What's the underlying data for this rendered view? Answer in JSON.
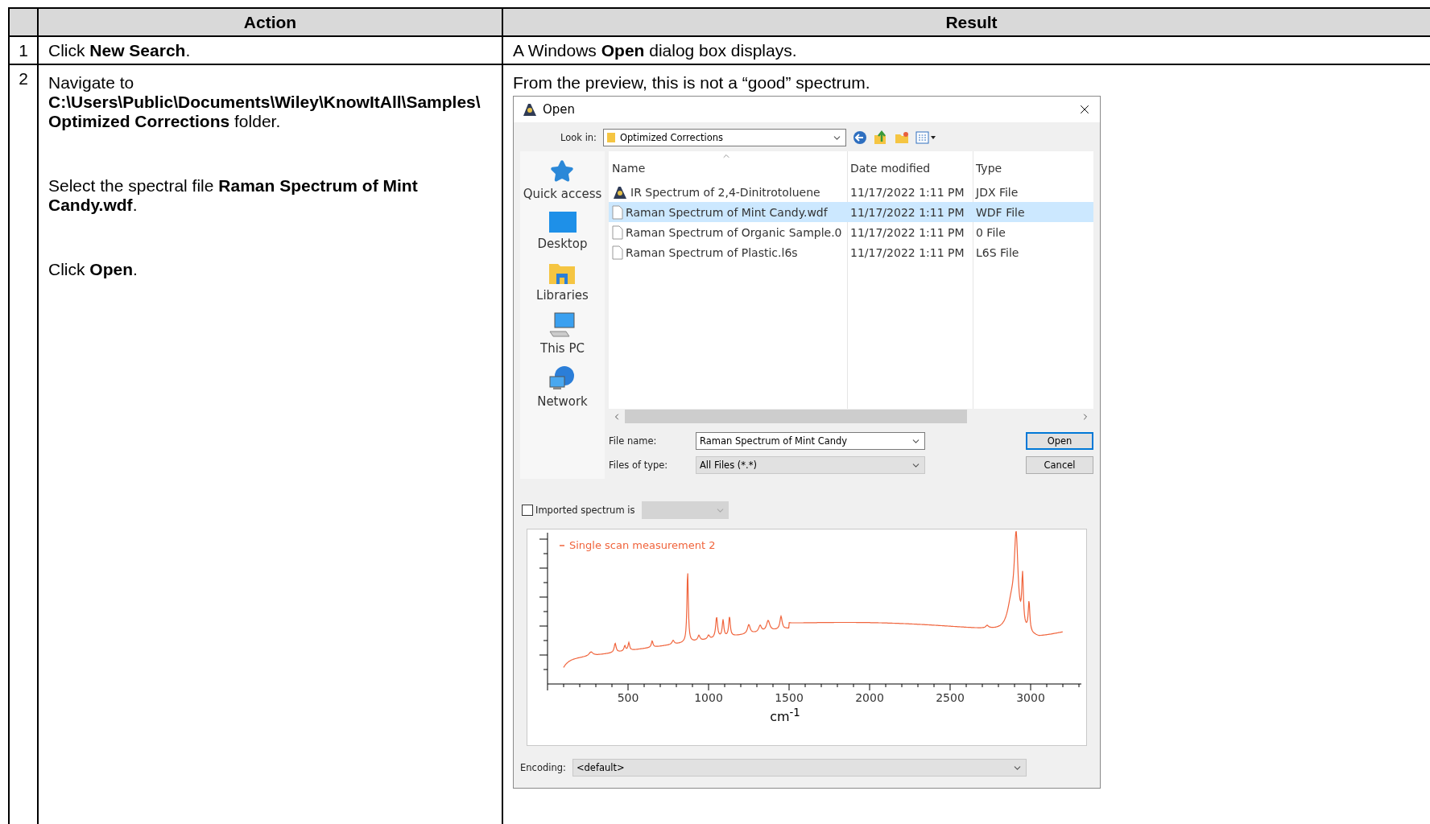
{
  "table": {
    "columns": [
      "Action",
      "Result"
    ],
    "rows": [
      {
        "step": "1",
        "action": [
          "Click **New Search**."
        ],
        "result": "A Windows **Open** dialog box displays."
      },
      {
        "step": "2",
        "action": [
          "Navigate to **C:\\Users\\Public\\Documents\\Wiley\\KnowItAll\\Samples\\Optimized Corrections** folder.",
          "Select the spectral file **Raman Spectrum of Mint Candy.wdf**.",
          "Click **Open**."
        ],
        "result": "From the preview, this is not a “good” spectrum.",
        "dialog": {
          "title": "Open",
          "look_in": {
            "label": "Look in:",
            "value": "Optimized Corrections"
          },
          "places": [
            {
              "label": "Quick access",
              "kind": "star"
            },
            {
              "label": "Desktop",
              "kind": "desktop"
            },
            {
              "label": "Libraries",
              "kind": "libraries"
            },
            {
              "label": "This PC",
              "kind": "pc"
            },
            {
              "label": "Network",
              "kind": "network"
            }
          ],
          "columns": [
            "Name",
            "Date modified",
            "Type"
          ],
          "files": [
            {
              "name": "IR Spectrum of 2,4-Dinitrotoluene",
              "date": "11/17/2022 1:11 PM",
              "type": "JDX File",
              "kind": "app",
              "selected": false
            },
            {
              "name": "Raman Spectrum of Mint Candy.wdf",
              "date": "11/17/2022 1:11 PM",
              "type": "WDF File",
              "kind": "doc",
              "selected": true
            },
            {
              "name": "Raman Spectrum of Organic Sample.0",
              "date": "11/17/2022 1:11 PM",
              "type": "0 File",
              "kind": "doc",
              "selected": false
            },
            {
              "name": "Raman Spectrum of Plastic.l6s",
              "date": "11/17/2022 1:11 PM",
              "type": "L6S File",
              "kind": "doc",
              "selected": false
            }
          ],
          "file_name": {
            "label": "File name:",
            "value": "Raman Spectrum of Mint Candy"
          },
          "file_type": {
            "label": "Files of type:",
            "value": "All Files (*.*)"
          },
          "buttons": [
            {
              "label": "Open",
              "default": true
            },
            {
              "label": "Cancel",
              "default": false
            }
          ],
          "imported": {
            "label": "Imported spectrum is",
            "checked": false
          },
          "preview": {
            "legend": "Single scan measurement 2",
            "x_tick_labels": [
              "500",
              "1000",
              "1500",
              "2000",
              "2500",
              "3000"
            ],
            "xlabel": "cm$^{-1}$"
          },
          "encoding": {
            "label": "Encoding:",
            "value": "<default>"
          }
        }
      }
    ]
  }
}
